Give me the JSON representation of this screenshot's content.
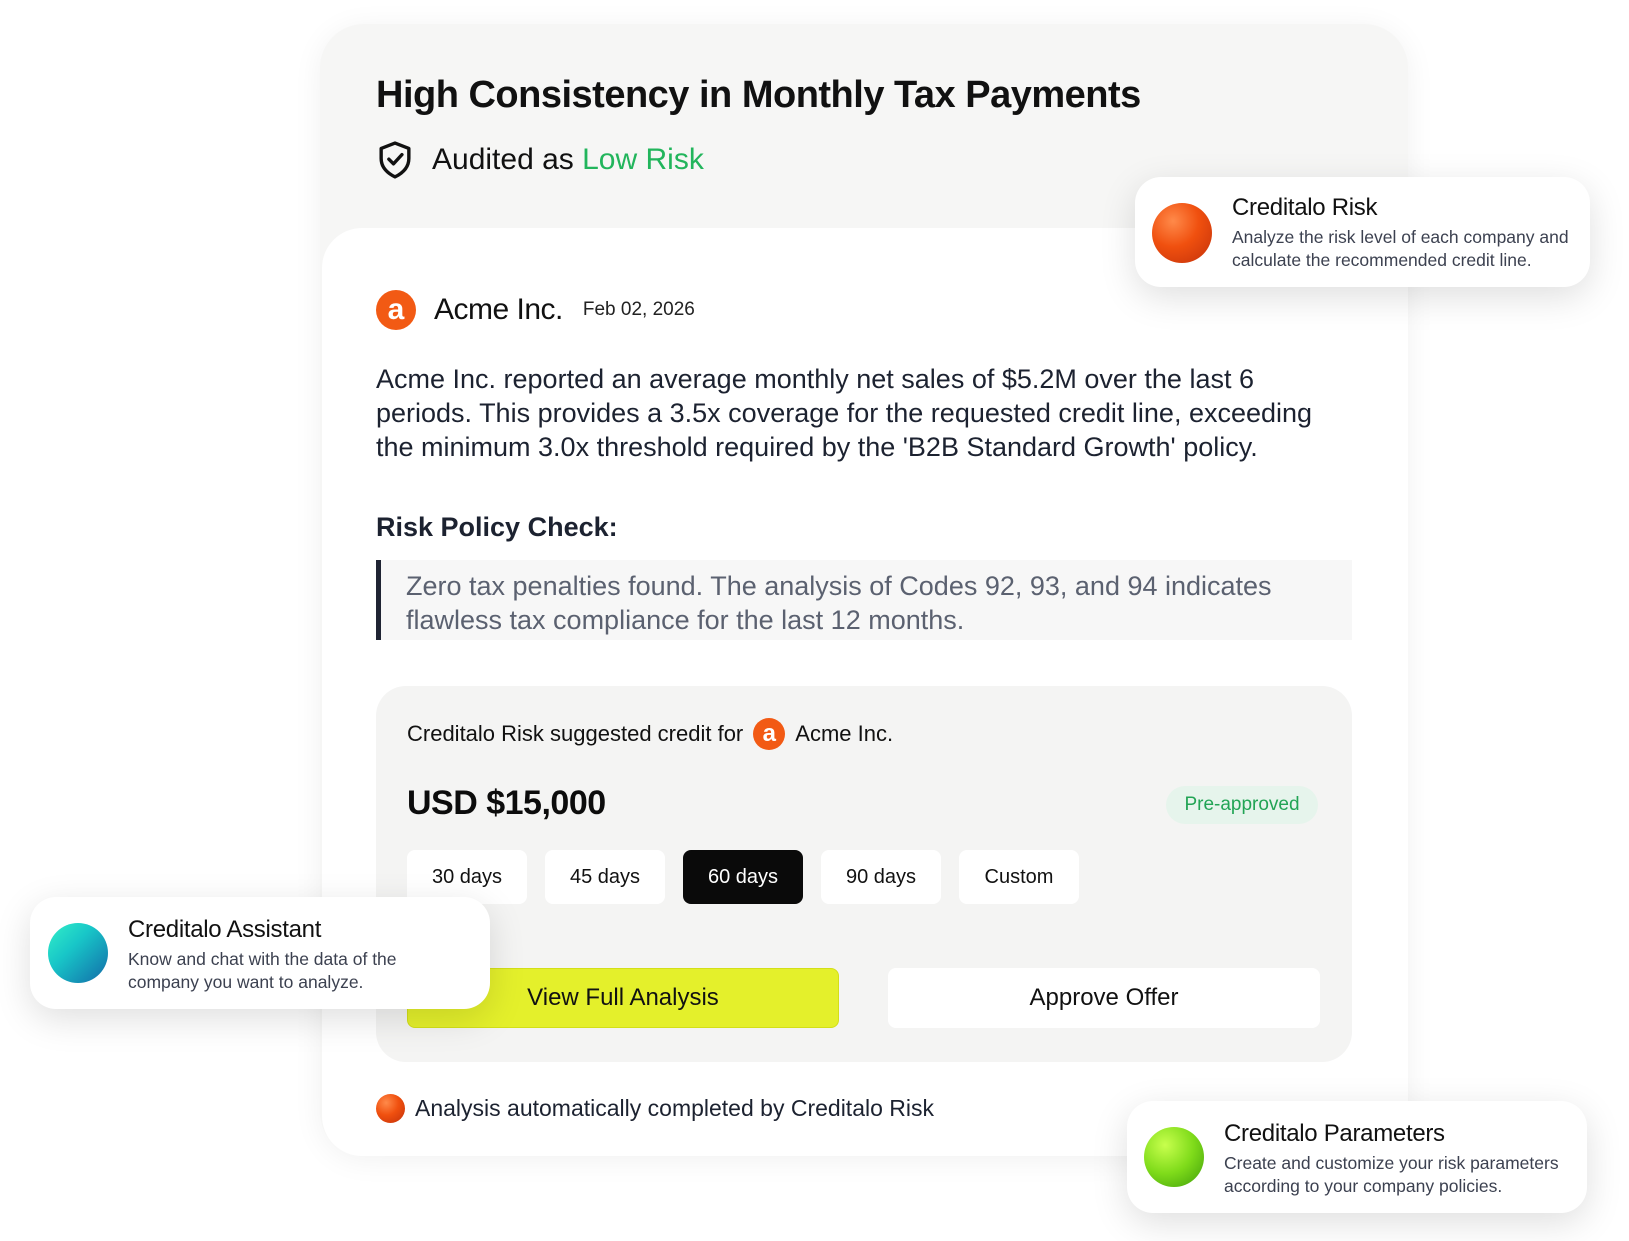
{
  "headline": "High Consistency in Monthly Tax Payments",
  "audit": {
    "prefix": "Audited as",
    "level": "Low Risk",
    "level_color": "#22b55c",
    "icon": "shield-check-icon"
  },
  "company": {
    "logo_letter": "a",
    "logo_color": "#f25a14",
    "name": "Acme Inc.",
    "date": "Feb 02, 2026"
  },
  "summary": "Acme Inc. reported an average monthly net sales of $5.2M over the last 6 periods. This provides a 3.5x coverage for the requested credit line, exceeding the minimum 3.0x threshold required by the 'B2B Standard Growth' policy.",
  "policy": {
    "title": "Risk Policy Check:",
    "quote": "Zero tax penalties found. The analysis of Codes 92, 93, and 94 indicates flawless tax compliance for the last 12 months."
  },
  "credit": {
    "title_prefix": "Creditalo Risk suggested credit for",
    "company": "Acme Inc.",
    "amount": "USD $15,000",
    "badge": "Pre-approved",
    "terms": [
      "30 days",
      "45 days",
      "60 days",
      "90 days",
      "Custom"
    ],
    "active_term": "60 days",
    "primary_button": "View Full Analysis",
    "primary_color": "#e4f02b",
    "secondary_button": "Approve Offer"
  },
  "footer_note": "Analysis automatically completed by Creditalo Risk",
  "floating_cards": {
    "risk": {
      "title": "Creditalo Risk",
      "description": "Analyze the risk level of each company and calculate the recommended credit line."
    },
    "assistant": {
      "title": "Creditalo Assistant",
      "description": "Know and chat with the data of the company you want to analyze."
    },
    "parameters": {
      "title": "Creditalo Parameters",
      "description": "Create and customize your risk parameters according to your company policies."
    }
  }
}
